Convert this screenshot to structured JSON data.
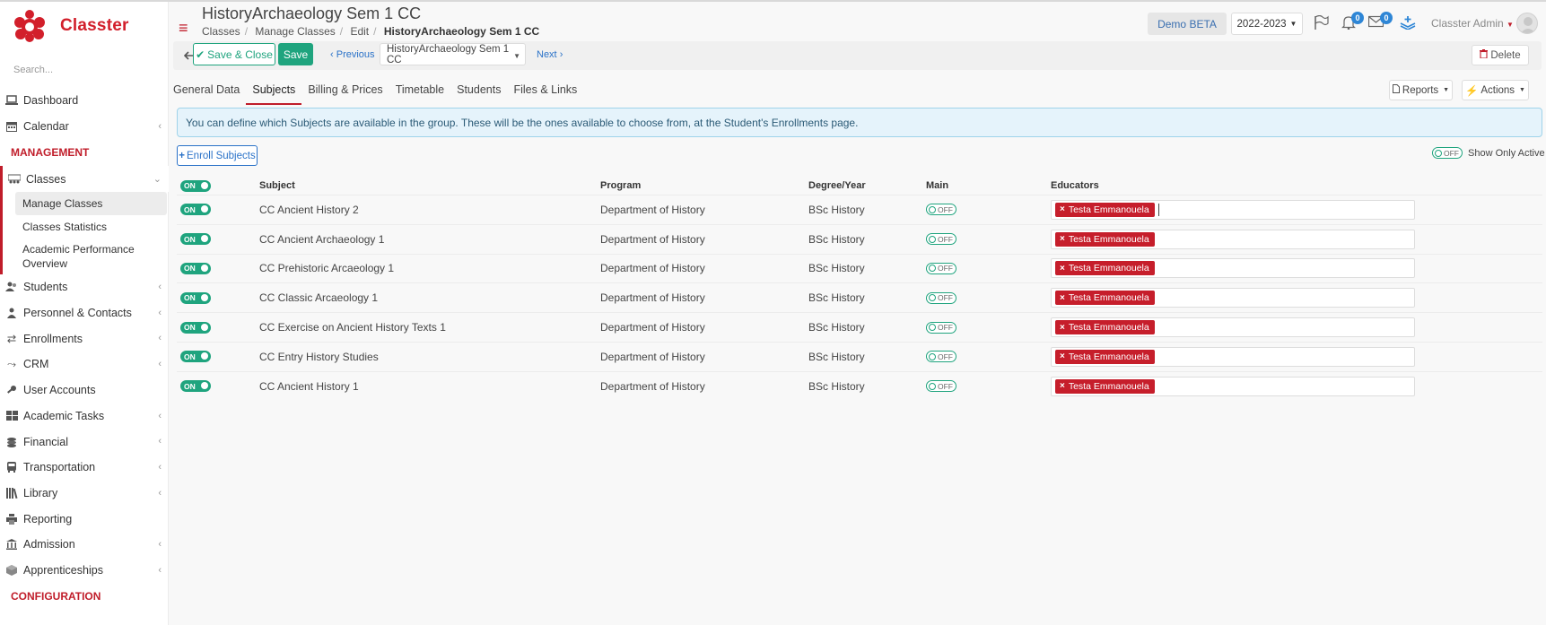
{
  "app": {
    "brand": "Classter",
    "search_placeholder": "Search..."
  },
  "colors": {
    "brand": "#c01d2a",
    "accent_green": "#1fa47e",
    "link_blue": "#2a72c8"
  },
  "sidebar": {
    "items_top": [
      {
        "label": "Dashboard",
        "icon": "laptop-icon"
      },
      {
        "label": "Calendar",
        "icon": "calendar-icon",
        "has_chevron": true
      }
    ],
    "section_management": "MANAGEMENT",
    "classes": {
      "label": "Classes",
      "icon": "classes-icon"
    },
    "classes_sub": [
      "Manage Classes",
      "Classes Statistics",
      "Academic Performance Overview"
    ],
    "items_rest": [
      {
        "label": "Students",
        "icon": "students-icon"
      },
      {
        "label": "Personnel & Contacts",
        "icon": "personnel-icon"
      },
      {
        "label": "Enrollments",
        "icon": "exchange-icon"
      },
      {
        "label": "CRM",
        "icon": "crm-icon"
      },
      {
        "label": "User Accounts",
        "icon": "key-icon"
      },
      {
        "label": "Academic Tasks",
        "icon": "tasks-icon"
      },
      {
        "label": "Financial",
        "icon": "coins-icon"
      },
      {
        "label": "Transportation",
        "icon": "bus-icon"
      },
      {
        "label": "Library",
        "icon": "library-icon"
      },
      {
        "label": "Reporting",
        "icon": "print-icon"
      },
      {
        "label": "Admission",
        "icon": "institution-icon"
      },
      {
        "label": "Apprenticeships",
        "icon": "cube-icon"
      }
    ],
    "section_configuration": "CONFIGURATION"
  },
  "header": {
    "title": "HistoryArchaeology Sem 1 CC",
    "breadcrumb": [
      "Classes",
      "Manage Classes",
      "Edit",
      "HistoryArchaeology Sem 1 CC"
    ],
    "demo_label": "Demo BETA",
    "year_label": "2022-2023",
    "notifications_count": "0",
    "messages_count": "0",
    "user_name": "Classter Admin"
  },
  "toolbar": {
    "save_close_label": "Save & Close",
    "save_label": "Save",
    "previous_label": "Previous",
    "selected_class": "HistoryArchaeology Sem 1 CC",
    "next_label": "Next",
    "delete_label": "Delete"
  },
  "tabs": [
    "General Data",
    "Subjects",
    "Billing & Prices",
    "Timetable",
    "Students",
    "Files & Links"
  ],
  "active_tab": "Subjects",
  "reports_label": "Reports",
  "actions_label": "Actions",
  "info_text": "You can define which Subjects are available in the group. These will be the ones available to choose from, at the Student's Enrollments page.",
  "enroll_label": "Enroll Subjects",
  "show_only_active": {
    "label": "Show Only Active",
    "toggle": "OFF"
  },
  "table": {
    "header_toggle": "ON",
    "columns": [
      "Subject",
      "Program",
      "Degree/Year",
      "Main",
      "Educators"
    ],
    "rows": [
      {
        "toggle": "ON",
        "subject": "CC Ancient History 2",
        "program": "Department of History",
        "degree": "BSc History",
        "main": "OFF",
        "educator": "Testa Emmanouela"
      },
      {
        "toggle": "ON",
        "subject": "CC Ancient Archaeology 1",
        "program": "Department of History",
        "degree": "BSc History",
        "main": "OFF",
        "educator": "Testa Emmanouela"
      },
      {
        "toggle": "ON",
        "subject": "CC Prehistoric Arcaeology 1",
        "program": "Department of History",
        "degree": "BSc History",
        "main": "OFF",
        "educator": "Testa Emmanouela"
      },
      {
        "toggle": "ON",
        "subject": "CC Classic Arcaeology 1",
        "program": "Department of History",
        "degree": "BSc History",
        "main": "OFF",
        "educator": "Testa Emmanouela"
      },
      {
        "toggle": "ON",
        "subject": "CC Exercise on Ancient History Texts 1",
        "program": "Department of History",
        "degree": "BSc History",
        "main": "OFF",
        "educator": "Testa Emmanouela"
      },
      {
        "toggle": "ON",
        "subject": "CC Entry History Studies",
        "program": "Department of History",
        "degree": "BSc History",
        "main": "OFF",
        "educator": "Testa Emmanouela"
      },
      {
        "toggle": "ON",
        "subject": "CC Ancient History 1",
        "program": "Department of History",
        "degree": "BSc History",
        "main": "OFF",
        "educator": "Testa Emmanouela"
      }
    ]
  }
}
